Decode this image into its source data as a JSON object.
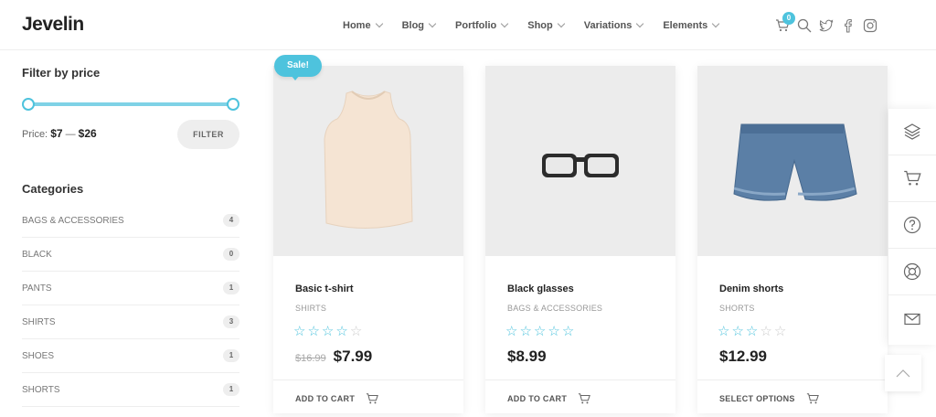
{
  "header": {
    "logo": "Jevelin",
    "nav": [
      {
        "label": "Home"
      },
      {
        "label": "Blog"
      },
      {
        "label": "Portfolio"
      },
      {
        "label": "Shop"
      },
      {
        "label": "Variations"
      },
      {
        "label": "Elements"
      }
    ],
    "cart_count": "0",
    "icons": [
      "cart-icon",
      "search-icon",
      "twitter-icon",
      "facebook-icon",
      "instagram-icon"
    ]
  },
  "sidebar": {
    "price_filter": {
      "title": "Filter by price",
      "price_label": "Price:",
      "min": "$7",
      "sep": "—",
      "max": "$26",
      "button": "FILTER"
    },
    "categories": {
      "title": "Categories",
      "items": [
        {
          "name": "BAGS & ACCESSORIES",
          "count": "4"
        },
        {
          "name": "BLACK",
          "count": "0"
        },
        {
          "name": "PANTS",
          "count": "1"
        },
        {
          "name": "SHIRTS",
          "count": "3"
        },
        {
          "name": "SHOES",
          "count": "1"
        },
        {
          "name": "SHORTS",
          "count": "1"
        }
      ]
    }
  },
  "products": [
    {
      "name": "Basic t-shirt",
      "category": "SHIRTS",
      "rating": 4,
      "old_price": "$16.99",
      "price": "$7.99",
      "action": "ADD TO CART",
      "sale": "Sale!"
    },
    {
      "name": "Black glasses",
      "category": "BAGS & ACCESSORIES",
      "rating": 5,
      "old_price": "",
      "price": "$8.99",
      "action": "ADD TO CART"
    },
    {
      "name": "Denim shorts",
      "category": "SHORTS",
      "rating": 3,
      "old_price": "",
      "price": "$12.99",
      "action": "SELECT OPTIONS"
    }
  ],
  "side_panel": [
    "layers-icon",
    "cart-icon",
    "help-icon",
    "support-icon",
    "mail-icon"
  ],
  "colors": {
    "accent": "#4ec3dd"
  }
}
